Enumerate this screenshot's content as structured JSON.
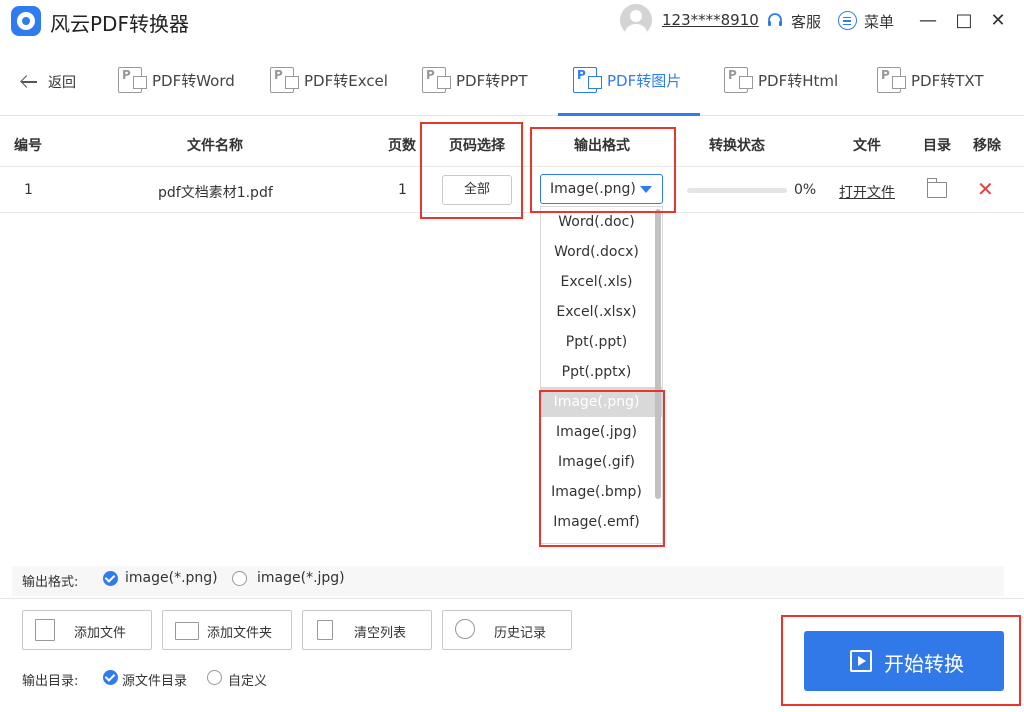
{
  "app": {
    "title": "风云PDF转换器",
    "username": "123****8910",
    "service_label": "客服",
    "menu_label": "菜单",
    "minimize": "—",
    "maximize": "□",
    "close": "✕"
  },
  "nav": {
    "back_label": "返回",
    "tabs": [
      {
        "label": "PDF转Word",
        "icon": "pdf-to-word-icon",
        "active": false
      },
      {
        "label": "PDF转Excel",
        "icon": "pdf-to-excel-icon",
        "active": false
      },
      {
        "label": "PDF转PPT",
        "icon": "pdf-to-ppt-icon",
        "active": false
      },
      {
        "label": "PDF转图片",
        "icon": "pdf-to-image-icon",
        "active": true
      },
      {
        "label": "PDF转Html",
        "icon": "pdf-to-html-icon",
        "active": false
      },
      {
        "label": "PDF转TXT",
        "icon": "pdf-to-txt-icon",
        "active": false
      }
    ]
  },
  "table": {
    "headers": {
      "index": "编号",
      "filename": "文件名称",
      "pages": "页数",
      "page_select": "页码选择",
      "output_format": "输出格式",
      "status": "转换状态",
      "file": "文件",
      "directory": "目录",
      "remove": "移除"
    },
    "rows": [
      {
        "index": "1",
        "filename": "pdf文档素材1.pdf",
        "pages": "1",
        "page_select": "全部",
        "format": "Image(.png)",
        "progress": 0,
        "progress_text": "0%",
        "open_file": "打开文件"
      }
    ]
  },
  "dropdown": {
    "options": [
      "Word(.doc)",
      "Word(.docx)",
      "Excel(.xls)",
      "Excel(.xlsx)",
      "Ppt(.ppt)",
      "Ppt(.pptx)",
      "Image(.png)",
      "Image(.jpg)",
      "Image(.gif)",
      "Image(.bmp)",
      "Image(.emf)"
    ],
    "selected": "Image(.png)"
  },
  "output_format": {
    "label": "输出格式:",
    "options": [
      {
        "label": "image(*.png)",
        "checked": true
      },
      {
        "label": "image(*.jpg)",
        "checked": false
      }
    ]
  },
  "actions": {
    "add_file": "添加文件",
    "add_folder": "添加文件夹",
    "clear_list": "清空列表",
    "history": "历史记录"
  },
  "output_dir": {
    "label": "输出目录:",
    "options": [
      {
        "label": "源文件目录",
        "checked": true
      },
      {
        "label": "自定义",
        "checked": false
      }
    ]
  },
  "start_button": "开始转换",
  "colors": {
    "accent": "#2f7cf0",
    "annotation": "#e8362f",
    "remove": "#e04040"
  }
}
